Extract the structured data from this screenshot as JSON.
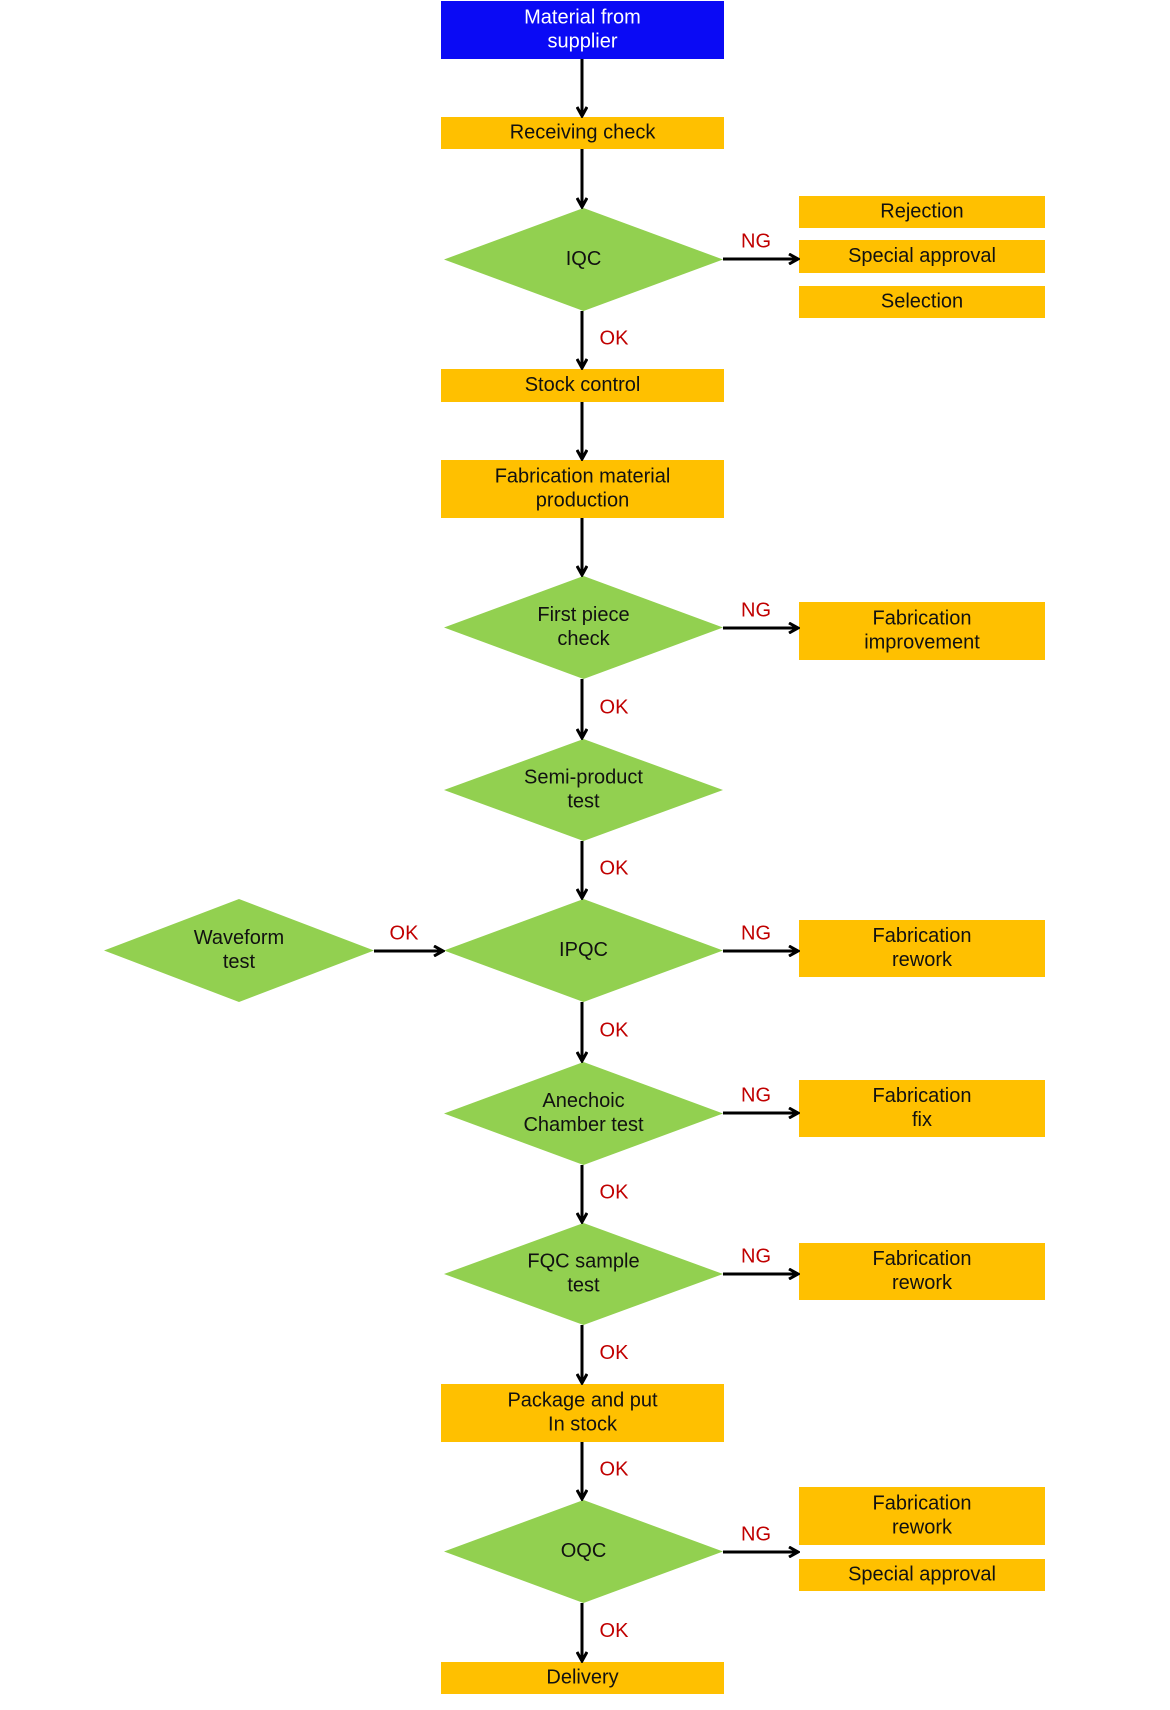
{
  "colors": {
    "start": "#0a0af5",
    "process": "#ffc000",
    "decision": "#92d050",
    "label": "#c00000"
  },
  "nodes": {
    "start": [
      "Material from",
      "supplier"
    ],
    "receiving": [
      "Receiving check"
    ],
    "iqc": [
      "IQC"
    ],
    "rejection": [
      "Rejection"
    ],
    "special1": [
      "Special approval"
    ],
    "selection": [
      "Selection"
    ],
    "stock": [
      "Stock control"
    ],
    "fabmat": [
      "Fabrication material",
      "production"
    ],
    "firstpiece": [
      "First piece",
      "check"
    ],
    "fabimprove": [
      "Fabrication",
      "improvement"
    ],
    "semi": [
      "Semi-product",
      "test"
    ],
    "ipqc": [
      "IPQC"
    ],
    "waveform": [
      "Waveform",
      "test"
    ],
    "rework1": [
      "Fabrication",
      "rework"
    ],
    "anechoic": [
      "Anechoic",
      "Chamber test"
    ],
    "fix": [
      "Fabrication",
      "fix"
    ],
    "fqc": [
      "FQC sample",
      "test"
    ],
    "rework2": [
      "Fabrication",
      "rework"
    ],
    "package": [
      "Package and put",
      "In stock"
    ],
    "oqc": [
      "OQC"
    ],
    "rework3": [
      "Fabrication",
      "rework"
    ],
    "special2": [
      "Special approval"
    ],
    "delivery": [
      "Delivery"
    ]
  },
  "labels": {
    "ok": "OK",
    "ng": "NG"
  }
}
